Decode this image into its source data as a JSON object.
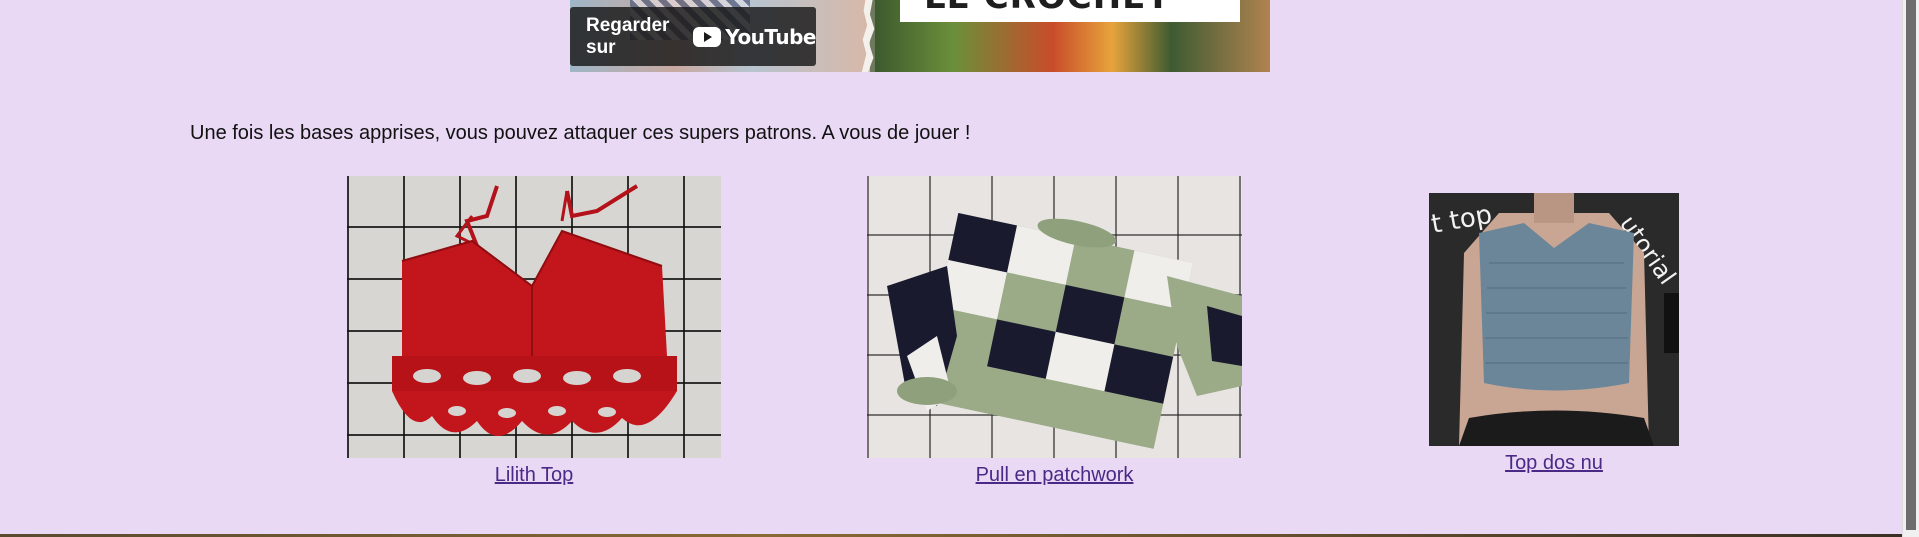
{
  "video": {
    "watch_label": "Regarder sur",
    "youtube_wordmark": "YouTube",
    "title_card_text": "LE CROCHET"
  },
  "content": {
    "intro_text": "Une fois les bases apprises, vous pouvez attaquer ces supers patrons. A vous de jouer !"
  },
  "patterns": [
    {
      "label": "Lilith Top",
      "image_icon": "red-crochet-halter-top-image"
    },
    {
      "label": "Pull en patchwork",
      "image_icon": "patchwork-sweater-image"
    },
    {
      "label": "Top dos nu",
      "image_icon": "blue-knit-top-image"
    }
  ],
  "colors": {
    "background": "#e9d9f5",
    "link": "#4a2a86",
    "text": "#111111"
  }
}
